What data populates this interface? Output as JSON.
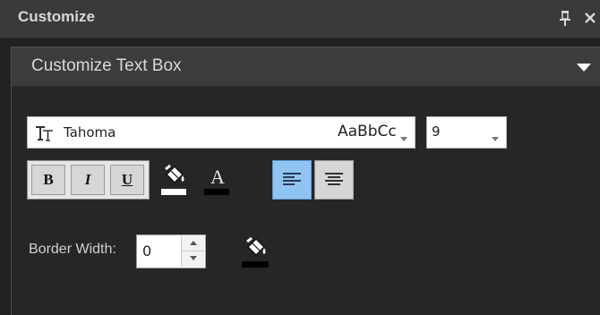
{
  "window": {
    "title": "Customize",
    "pin_icon": "pin-icon",
    "close_icon": "close-icon"
  },
  "section": {
    "title": "Customize Text Box",
    "collapse_icon": "triangle-down-icon"
  },
  "font": {
    "name": "Tahoma",
    "preview": "AaBbCc",
    "icon": "truetype-font-icon",
    "size": "9"
  },
  "format_buttons": {
    "bold": "B",
    "italic": "I",
    "underline": "U"
  },
  "fill_color": {
    "icon": "paint-bucket-icon",
    "color": "#ffffff"
  },
  "font_color": {
    "label": "A",
    "color": "#000000"
  },
  "alignment": {
    "selected": "left",
    "accent": "#8fc4f2"
  },
  "border": {
    "label": "Border Width:",
    "value": "0",
    "color_icon": "paint-bucket-icon",
    "color": "#000000"
  }
}
